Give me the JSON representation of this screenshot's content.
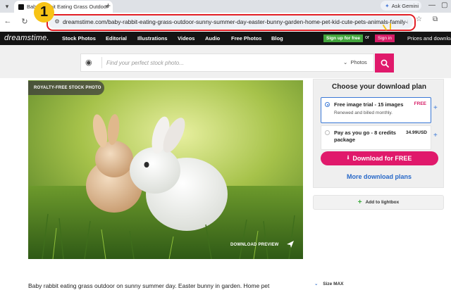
{
  "browser": {
    "tab_title": "Baby Rabbit Eating Grass Outdoor",
    "new_tab": "+",
    "gemini_label": "Ask Gemini",
    "url": "dreamstime.com/baby-rabbit-eating-grass-outdoor-sunny-summer-day-easter-bunny-garden-home-pet-kid-cute-pets-animals-family-im..."
  },
  "annotation": {
    "step": "1",
    "highlight_color": "#e21f26",
    "badge_color": "#f7c315"
  },
  "site": {
    "logo": "dreamstime.",
    "nav": [
      "Stock Photos",
      "Editorial",
      "Illustrations",
      "Videos",
      "Audio",
      "Free Photos",
      "Blog"
    ],
    "signup": "Sign up for free",
    "or": "or",
    "signin": "Sign in",
    "prices": "Prices and download"
  },
  "search": {
    "placeholder": "Find your perfect stock photo...",
    "type": "Photos"
  },
  "photo": {
    "tag": "ROYALTY-FREE STOCK PHOTO",
    "download_preview": "DOWNLOAD PREVIEW"
  },
  "plan": {
    "title": "Choose your download plan",
    "option1": {
      "title": "Free image trial - 15 images",
      "sub": "Renewed and billed monthly.",
      "badge": "FREE"
    },
    "option2": {
      "title": "Pay as you go - 8 credits package",
      "price": "34.99USD"
    },
    "download_btn": "Download for FREE",
    "more": "More download plans",
    "lightbox": "Add to lightbox"
  },
  "caption": "Baby rabbit eating grass outdoor on sunny summer day. Easter bunny in garden. Home pet",
  "size": "Size MAX",
  "colors": {
    "accent": "#e0196b",
    "link": "#2768c8",
    "nav_bg": "#141414",
    "signup": "#42a53c"
  }
}
